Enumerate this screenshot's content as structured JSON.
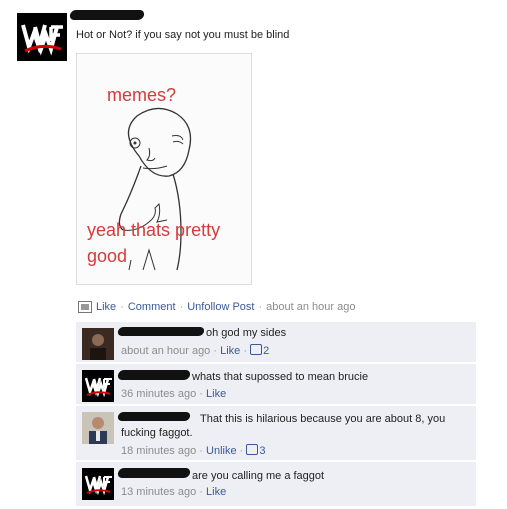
{
  "post": {
    "text": "Hot or Not? if you say not you must be blind",
    "image": {
      "top_text": "memes?",
      "bottom_text": "yeah thats pretty good"
    }
  },
  "actions": {
    "like": "Like",
    "comment": "Comment",
    "unfollow": "Unfollow Post",
    "time": "about an hour ago"
  },
  "comments": [
    {
      "text": "oh god my sides",
      "time": "about an hour ago",
      "action": "Like",
      "likes": "2"
    },
    {
      "text": "whats that supossed to mean brucie",
      "time": "36 minutes ago",
      "action": "Like"
    },
    {
      "text": "That this is hilarious because you are about 8, you",
      "text2": "fucking faggot.",
      "time": "18 minutes ago",
      "action": "Unlike",
      "likes": "3"
    },
    {
      "text": "are you calling me a faggot",
      "time": "13 minutes ago",
      "action": "Like"
    }
  ],
  "colors": {
    "link": "#3b5998",
    "comment_bg": "#edeff4",
    "meme_text": "#d63a3a"
  },
  "icons": [
    "wwf-logo-icon",
    "thumbs-up-icon",
    "post-type-icon"
  ]
}
